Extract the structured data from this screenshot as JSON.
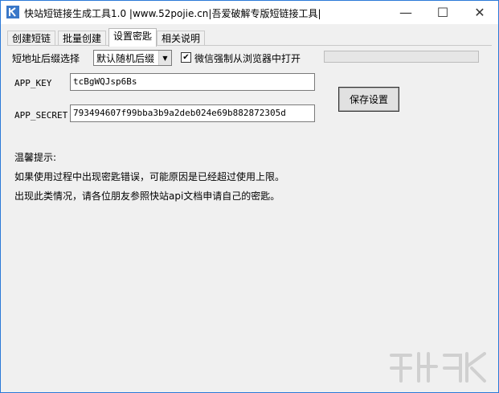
{
  "window": {
    "title": "快站短链接生成工具1.0 |www.52pojie.cn|吾爱破解专版短链接工具|",
    "controls": {
      "minimize": "—",
      "maximize": "☐",
      "close": "✕"
    }
  },
  "tabs": [
    {
      "label": "创建短链"
    },
    {
      "label": "批量创建"
    },
    {
      "label": "设置密匙"
    },
    {
      "label": "相关说明"
    }
  ],
  "settings": {
    "suffix_label": "短地址后缀选择",
    "suffix_value": "默认随机后缀",
    "wechat_checkbox_label": "微信强制从浏览器中打开",
    "wechat_checked": true,
    "app_key_label": "APP_KEY",
    "app_key_value": "tcBgWQJsp6Bs",
    "app_secret_label": "APP_SECRET",
    "app_secret_value": "793494607f99bba3b9a2deb024e69b882872305d",
    "save_button": "保存设置"
  },
  "tips": {
    "heading": "温馨提示:",
    "line1": "如果使用过程中出现密匙错误，可能原因是已经超过使用上限。",
    "line2": "出现此类情况，请各位朋友参照快站api文档申请自己的密匙。"
  },
  "colors": {
    "accent": "#2b79d8",
    "icon_blue": "#3a78c8"
  },
  "icons": {
    "app": "k-logo-icon",
    "dropdown": "chevron-down-icon",
    "check": "checkmark-icon"
  }
}
